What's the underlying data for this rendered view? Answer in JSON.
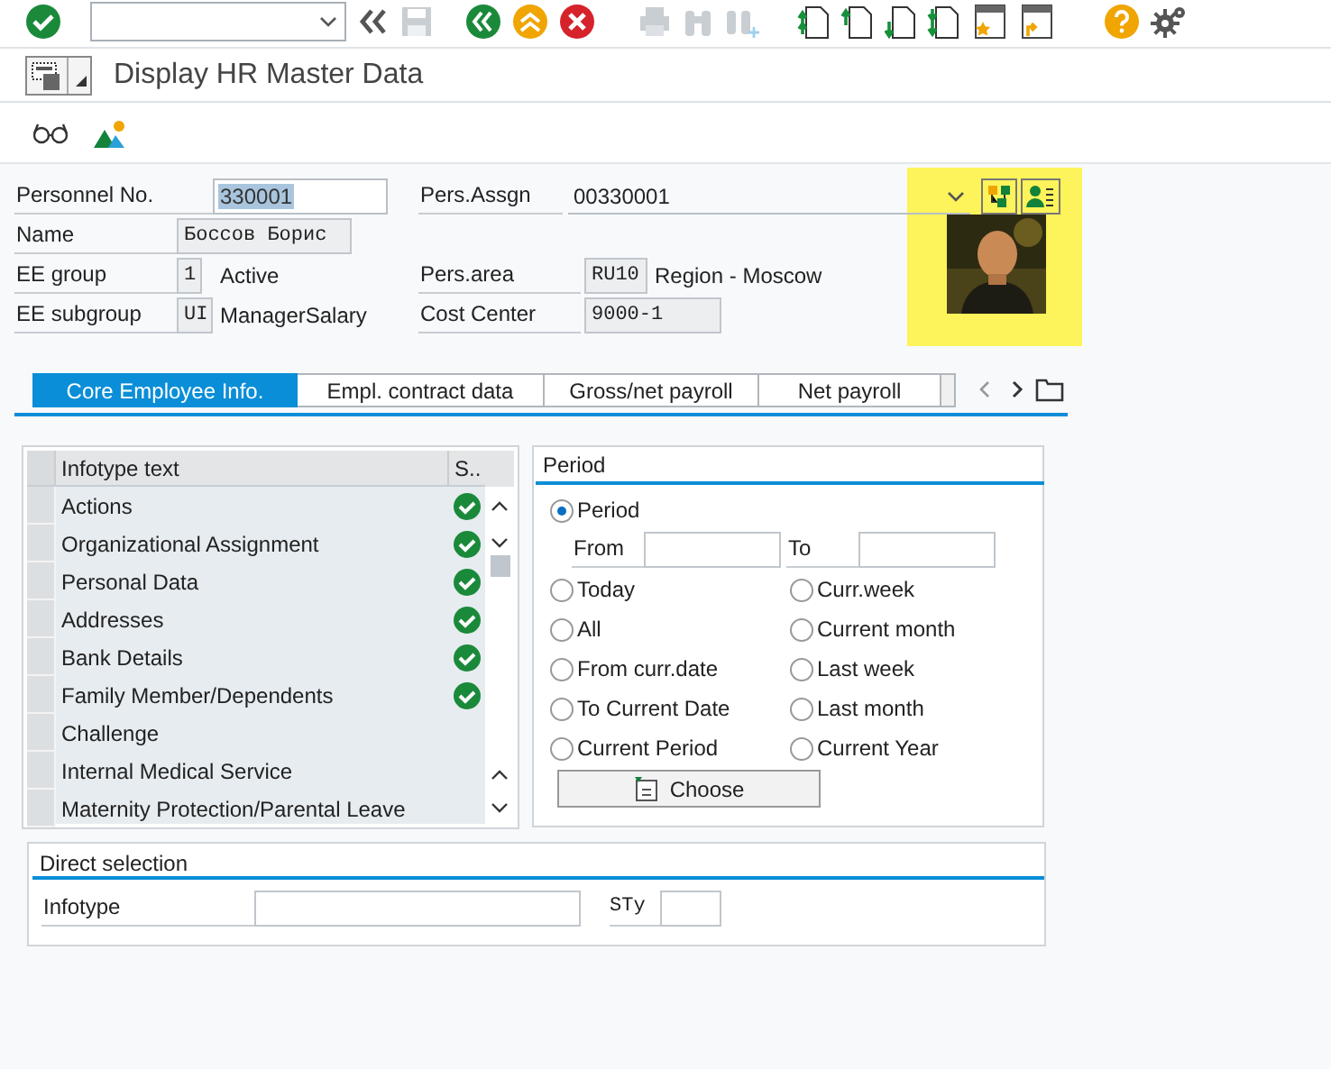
{
  "title": "Display HR Master Data",
  "header": {
    "personnel_no": {
      "label": "Personnel No.",
      "value": "330001"
    },
    "pers_assgn": {
      "label": "Pers.Assgn",
      "value": "00330001"
    },
    "name": {
      "label": "Name",
      "value": "Боссов Борис"
    },
    "ee_group": {
      "label": "EE group",
      "code": "1",
      "text": "Active"
    },
    "pers_area": {
      "label": "Pers.area",
      "code": "RU10",
      "text": "Region - Moscow"
    },
    "ee_subgroup": {
      "label": "EE subgroup",
      "code": "UI",
      "text": "ManagerSalary"
    },
    "cost_center": {
      "label": "Cost Center",
      "value": "9000-1"
    }
  },
  "tabs": [
    {
      "label": "Core Employee Info.",
      "selected": true
    },
    {
      "label": "Empl. contract data",
      "selected": false
    },
    {
      "label": "Gross/net payroll",
      "selected": false
    },
    {
      "label": "Net payroll",
      "selected": false
    }
  ],
  "infotype_table": {
    "columns": [
      "Infotype text",
      "S.."
    ],
    "rows": [
      {
        "text": "Actions",
        "status": true
      },
      {
        "text": "Organizational Assignment",
        "status": true
      },
      {
        "text": "Personal Data",
        "status": true
      },
      {
        "text": "Addresses",
        "status": true
      },
      {
        "text": "Bank Details",
        "status": true
      },
      {
        "text": "Family Member/Dependents",
        "status": true
      },
      {
        "text": "Challenge",
        "status": false
      },
      {
        "text": "Internal Medical Service",
        "status": false
      },
      {
        "text": "Maternity Protection/Parental Leave",
        "status": false
      }
    ]
  },
  "period": {
    "title": "Period",
    "main_option": {
      "label": "Period",
      "selected": true
    },
    "from_label": "From",
    "to_label": "To",
    "options": [
      {
        "label": "Today",
        "selected": false
      },
      {
        "label": "Curr.week",
        "selected": false
      },
      {
        "label": "All",
        "selected": false
      },
      {
        "label": "Current month",
        "selected": false
      },
      {
        "label": "From curr.date",
        "selected": false
      },
      {
        "label": "Last week",
        "selected": false
      },
      {
        "label": "To Current Date",
        "selected": false
      },
      {
        "label": "Last month",
        "selected": false
      },
      {
        "label": "Current Period",
        "selected": false
      },
      {
        "label": "Current Year",
        "selected": false
      }
    ],
    "button": "Choose"
  },
  "direct_selection": {
    "title": "Direct selection",
    "infotype_label": "Infotype",
    "sty_label": "STy"
  }
}
